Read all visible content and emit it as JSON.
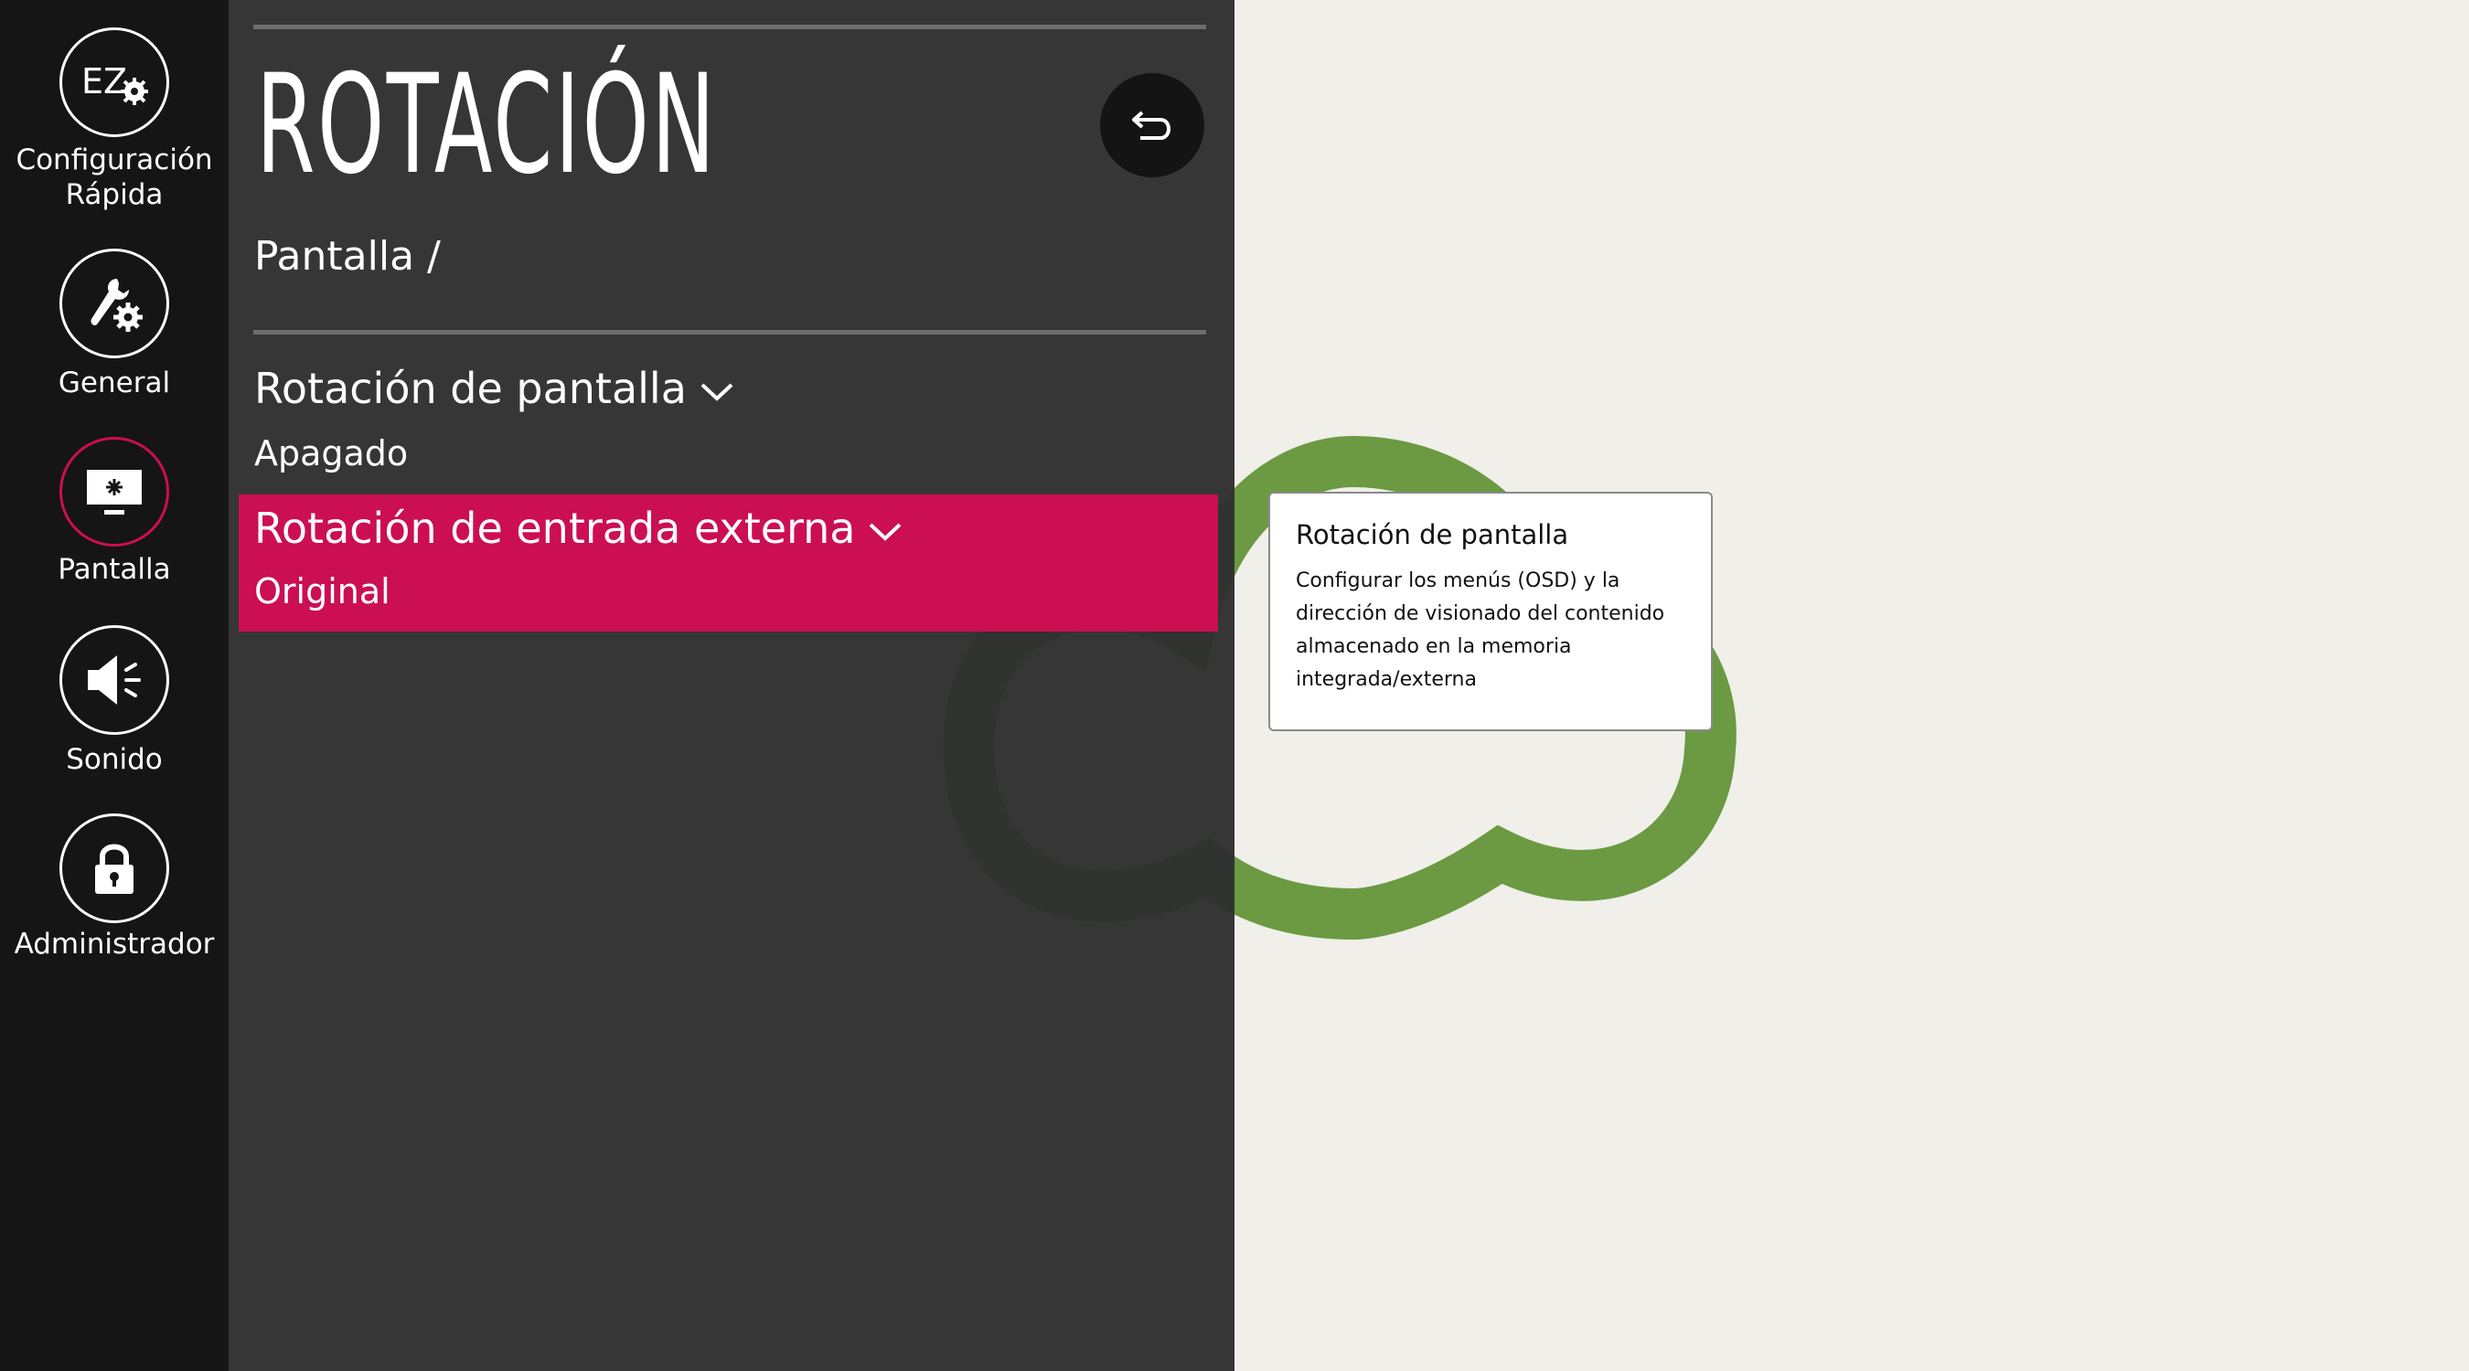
{
  "sidebar": {
    "items": [
      {
        "label": "Configuración Rápida",
        "icon": "ez-settings-icon"
      },
      {
        "label": "General",
        "icon": "wrench-gear-icon"
      },
      {
        "label": "Pantalla",
        "icon": "monitor-icon",
        "active": true
      },
      {
        "label": "Sonido",
        "icon": "speaker-icon"
      },
      {
        "label": "Administrador",
        "icon": "lock-icon"
      }
    ],
    "ez_text": "EZ"
  },
  "panel": {
    "title": "ROTACIÓN",
    "breadcrumb": "Pantalla /",
    "back_icon": "back-arrow-icon",
    "options": [
      {
        "title": "Rotación de pantalla",
        "value": "Apagado"
      },
      {
        "title": "Rotación de entrada externa",
        "value": "Original",
        "selected": true
      }
    ]
  },
  "tooltip": {
    "title": "Rotación de pantalla",
    "body": "Configurar los menús (OSD) y la dirección de visionado del contenido almacenado en la memoria integrada/externa"
  },
  "colors": {
    "accent": "#cc0e52",
    "sidebar_bg": "#151515",
    "panel_bg": "#303030",
    "background": "#f0efea",
    "cloud": "#6b9a42"
  }
}
